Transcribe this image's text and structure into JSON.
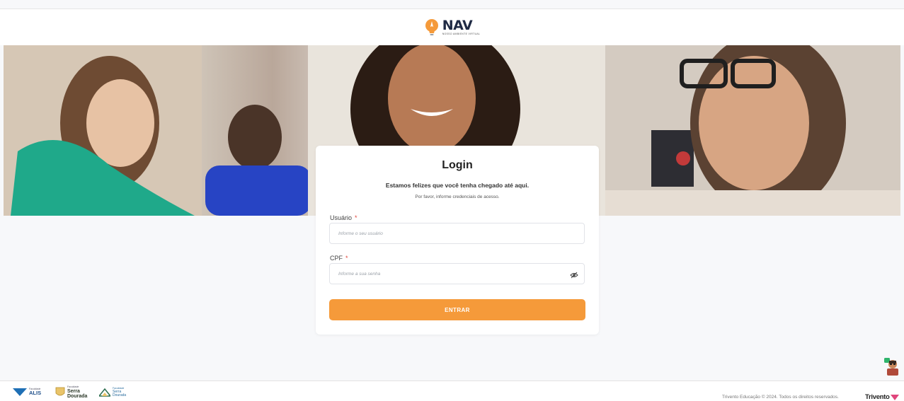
{
  "header": {
    "logo_word": "NAV",
    "logo_sub": "NOSSO AMBIENTE VIRTUAL"
  },
  "login": {
    "title": "Login",
    "subtitle": "Estamos felizes que você tenha chegado até aqui.",
    "hint": "Por favor, informe credenciais de acesso.",
    "user": {
      "label": "Usuário",
      "required_mark": "*",
      "placeholder": "Informe o seu usuário",
      "value": ""
    },
    "cpf": {
      "label": "CPF",
      "required_mark": "*",
      "placeholder": "Informe a sua senha",
      "value": "",
      "toggle_icon": "eye-slash-icon"
    },
    "submit_label": "ENTRAR"
  },
  "footer": {
    "brands": [
      {
        "small": "Faculdade",
        "name": "ALIS"
      },
      {
        "small": "Faculdade",
        "name": "Serra Dourada"
      },
      {
        "small": "Faculdade",
        "name": "Serra Dourada"
      }
    ],
    "copyright": "Trivento Educação © 2024. Todos os direitos reservados.",
    "company": "Trivento"
  },
  "colors": {
    "accent": "#f59a3a",
    "required": "#e0463c",
    "navy": "#1f2a44"
  }
}
